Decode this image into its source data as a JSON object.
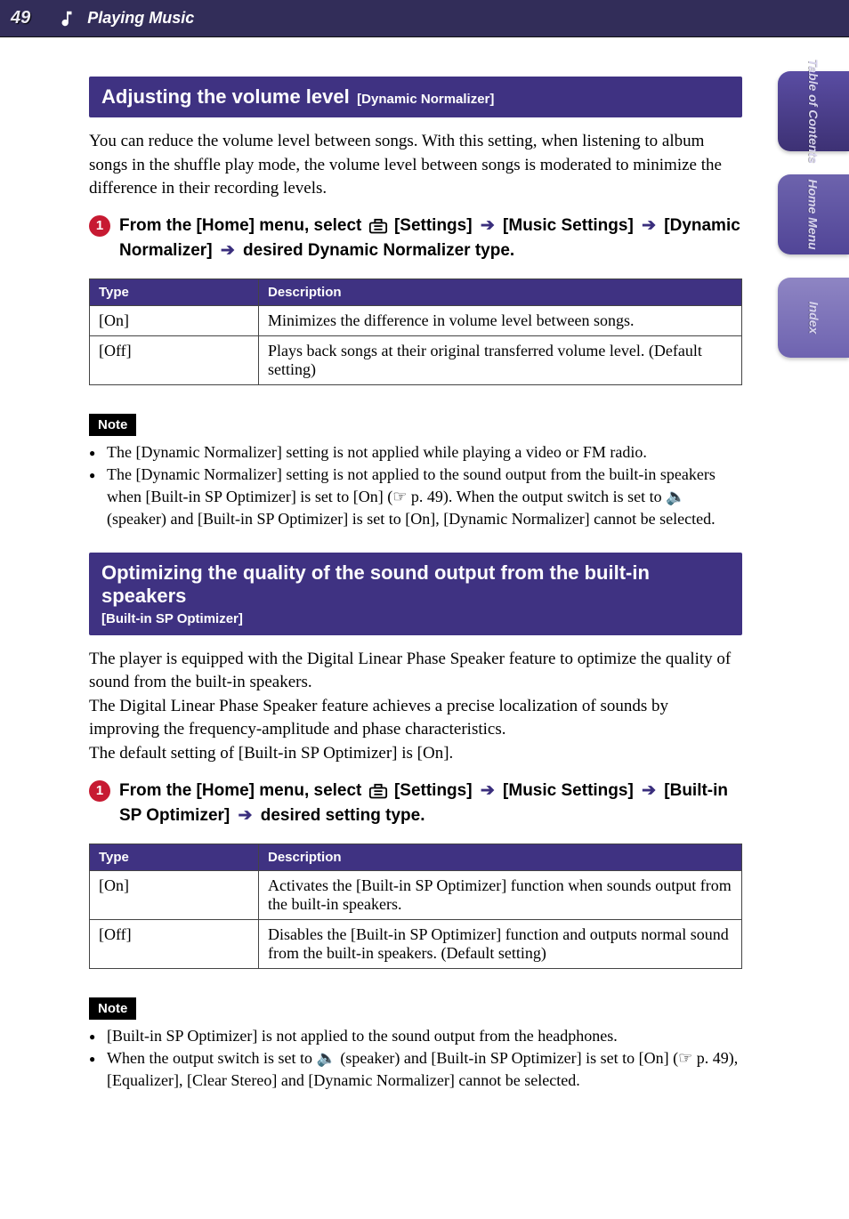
{
  "header": {
    "page_number": "49",
    "icon": "music-note-icon",
    "section_title": "Playing Music"
  },
  "side_tabs": [
    {
      "label": "Table of\nContents"
    },
    {
      "label": "Home\nMenu"
    },
    {
      "label": "Index"
    }
  ],
  "sections": [
    {
      "bar_title": "Adjusting the volume level",
      "bar_sub": "[Dynamic Normalizer]",
      "multiline_bar": false,
      "intro": "You can reduce the volume level between songs. With this setting, when listening to album songs in the shuffle play mode, the volume level between songs is moderated to minimize the difference in their recording levels.",
      "step": {
        "num": "1",
        "segments": [
          {
            "t": "From the [Home] menu, select "
          },
          {
            "icon": "settings-case-icon"
          },
          {
            "t": " [Settings] "
          },
          {
            "arrow": true
          },
          {
            "t": " [Music Settings] "
          },
          {
            "arrow": true
          },
          {
            "t": " [Dynamic Normalizer] "
          },
          {
            "arrow": true
          },
          {
            "t": " desired Dynamic Normalizer type."
          }
        ]
      },
      "table": {
        "headers": [
          "Type",
          "Description"
        ],
        "rows": [
          [
            "[On]",
            "Minimizes the difference in volume level between songs."
          ],
          [
            "[Off]",
            "Plays back songs at their original transferred volume level. (Default setting)"
          ]
        ]
      },
      "note_label": "Note",
      "notes": [
        "The [Dynamic Normalizer] setting is not applied while playing a video or FM radio.",
        "The [Dynamic Normalizer] setting is not applied to the sound output from the built-in speakers when [Built-in SP Optimizer] is set to [On] (☞ p. 49). When the output switch is set to 🔈 (speaker) and [Built-in SP Optimizer] is set to [On], [Dynamic Normalizer] cannot be selected."
      ]
    },
    {
      "bar_title": "Optimizing the quality of the sound output from the built-in speakers",
      "bar_sub": "[Built-in SP Optimizer]",
      "multiline_bar": true,
      "intro": "The player is equipped with the Digital Linear Phase Speaker feature to optimize the quality of sound from the built-in speakers.\nThe Digital Linear Phase Speaker feature achieves a precise localization of sounds by improving the frequency-amplitude and phase characteristics.\nThe default setting of [Built-in SP Optimizer] is [On].",
      "step": {
        "num": "1",
        "segments": [
          {
            "t": "From the [Home] menu, select "
          },
          {
            "icon": "settings-case-icon"
          },
          {
            "t": " [Settings] "
          },
          {
            "arrow": true
          },
          {
            "t": " [Music Settings] "
          },
          {
            "arrow": true
          },
          {
            "t": " [Built-in SP Optimizer] "
          },
          {
            "arrow": true
          },
          {
            "t": " desired setting type."
          }
        ]
      },
      "table": {
        "headers": [
          "Type",
          "Description"
        ],
        "rows": [
          [
            "[On]",
            "Activates the [Built-in SP Optimizer] function when sounds output from the built-in speakers."
          ],
          [
            "[Off]",
            "Disables the [Built-in SP Optimizer] function and outputs normal sound from the built-in speakers. (Default setting)"
          ]
        ]
      },
      "note_label": "Note",
      "notes": [
        "[Built-in SP Optimizer] is not applied to the sound output from the headphones.",
        "When the output switch is set to 🔈 (speaker) and [Built-in SP Optimizer] is set to [On] (☞ p. 49), [Equalizer], [Clear Stereo] and [Dynamic Normalizer] cannot be selected."
      ]
    }
  ]
}
